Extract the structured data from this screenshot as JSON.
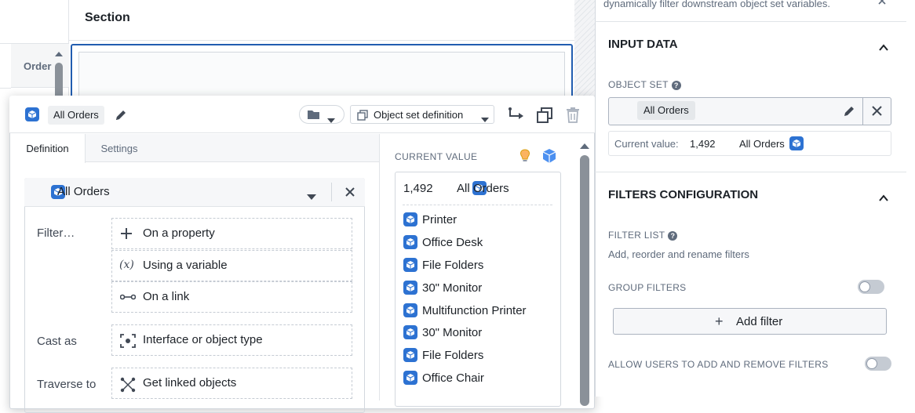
{
  "canvas": {
    "section_title": "Section",
    "order_column_label": "Order"
  },
  "popover": {
    "object_name": "All Orders",
    "object_set_definition_label": "Object set definition",
    "tabs": [
      "Definition",
      "Settings"
    ],
    "definition": {
      "object_type_name": "All Orders",
      "filter_label": "Filter…",
      "filter_options": [
        "On a property",
        "Using a variable",
        "On a link"
      ],
      "variable_glyph": "(x)",
      "cast_as_label": "Cast as",
      "cast_as_option": "Interface or object type",
      "traverse_to_label": "Traverse to",
      "traverse_to_option": "Get linked objects"
    },
    "current_value": {
      "label": "CURRENT VALUE",
      "count": "1,492",
      "name": "All Orders",
      "items": [
        "Printer",
        "Office Desk",
        "File Folders",
        "30\" Monitor",
        "Multifunction Printer",
        "30\" Monitor",
        "File Folders",
        "Office Chair"
      ]
    }
  },
  "right_panel": {
    "top_text": "dynamically filter downstream object set variables.",
    "input_data": {
      "heading": "INPUT DATA",
      "object_set_label": "OBJECT SET",
      "object_set_value": "All Orders",
      "current_value_label": "Current value:",
      "current_value_count": "1,492",
      "current_value_name": "All Orders"
    },
    "filters_configuration": {
      "heading": "FILTERS CONFIGURATION",
      "filter_list_label": "FILTER LIST",
      "filter_list_description": "Add, reorder and rename filters",
      "group_filters_label": "GROUP FILTERS",
      "group_filters_enabled": false,
      "add_filter_label": "Add filter",
      "allow_users_label": "ALLOW USERS TO ADD AND REMOVE FILTERS",
      "allow_users_enabled": false
    }
  },
  "colors": {
    "accent": "#2d72d2",
    "selection_border": "#215db0"
  }
}
